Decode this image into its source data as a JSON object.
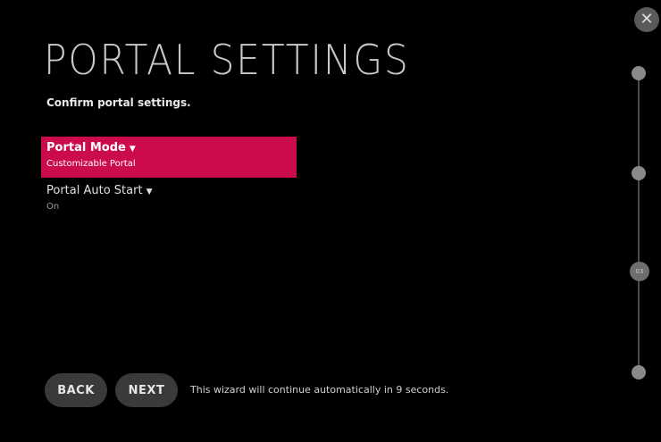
{
  "header": {
    "title": "PORTAL SETTINGS",
    "subtitle": "Confirm portal settings."
  },
  "settings": [
    {
      "label": "Portal Mode",
      "value": "Customizable Portal",
      "selected": true
    },
    {
      "label": "Portal Auto Start",
      "value": "On",
      "selected": false
    }
  ],
  "footer": {
    "back_label": "BACK",
    "next_label": "NEXT",
    "message": "This wizard will continue automatically in 9 seconds."
  },
  "progress": {
    "current_step_label": "03",
    "current_step": 3,
    "total_steps": 4
  },
  "icons": {
    "close": "close-icon",
    "chevron": "chevron-down-icon"
  },
  "colors": {
    "background": "#000000",
    "accent": "#cc0a4e",
    "button": "#3a3a3a"
  }
}
